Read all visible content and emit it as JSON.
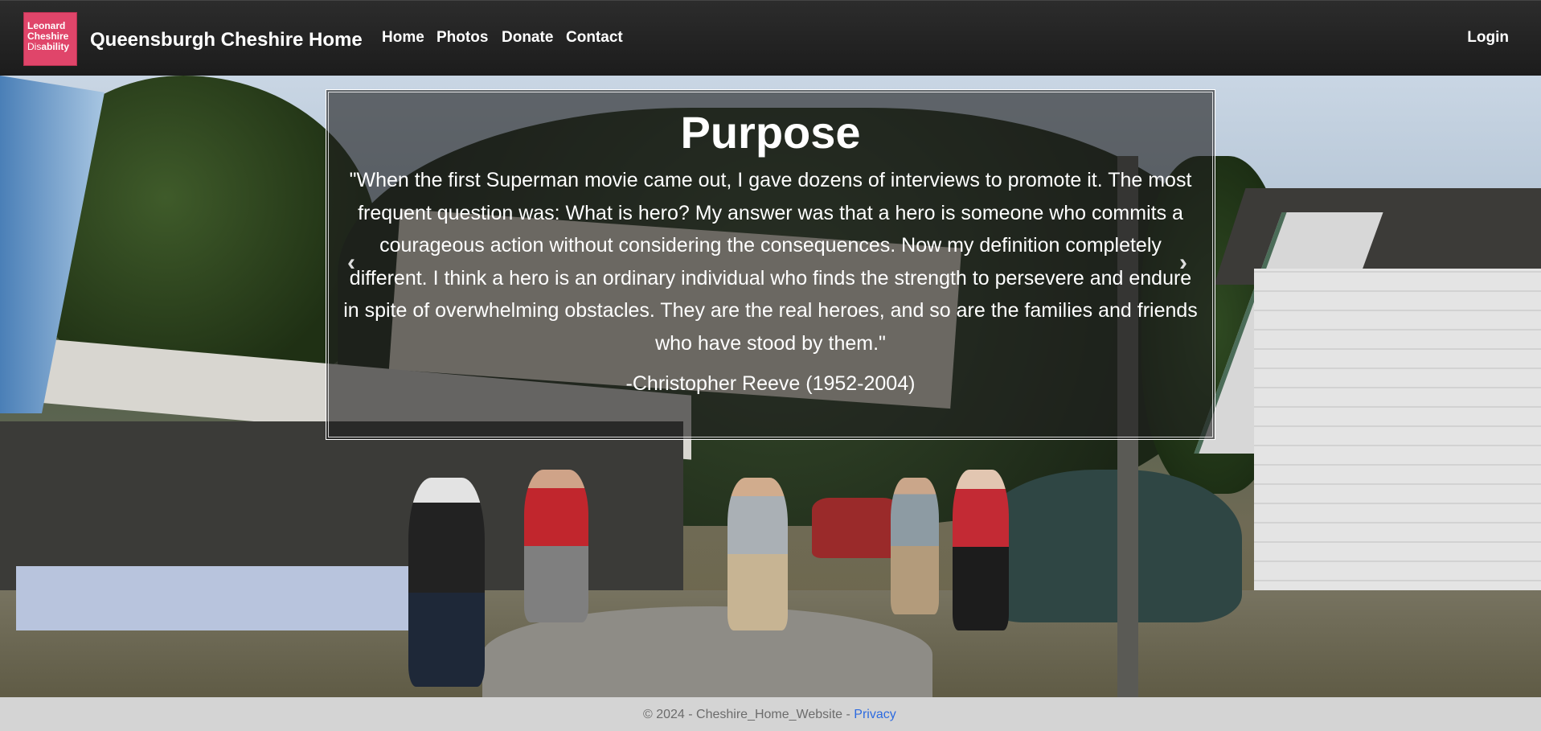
{
  "navbar": {
    "logo": {
      "line1": "Leonard",
      "line2": "Cheshire",
      "line3_a": "Dis",
      "line3_b": "ability"
    },
    "brand": "Queensburgh Cheshire Home",
    "links": [
      "Home",
      "Photos",
      "Donate",
      "Contact"
    ],
    "login": "Login"
  },
  "carousel": {
    "title": "Purpose",
    "quote": "\"When the first Superman movie came out, I gave dozens of interviews to promote it. The most frequent question was: What is hero? My answer was that a hero is someone who commits a courageous action without considering the consequences. Now my definition completely different. I think a hero is an ordinary individual who finds the strength to persevere and endure in spite of overwhelming obstacles. They are the real heroes, and so are the families and friends who have stood by them.\"",
    "author": "-Christopher Reeve (1952-2004)",
    "prev_icon": "‹",
    "next_icon": "›"
  },
  "footer": {
    "text": "© 2024 - Cheshire_Home_Website - ",
    "privacy": "Privacy"
  }
}
